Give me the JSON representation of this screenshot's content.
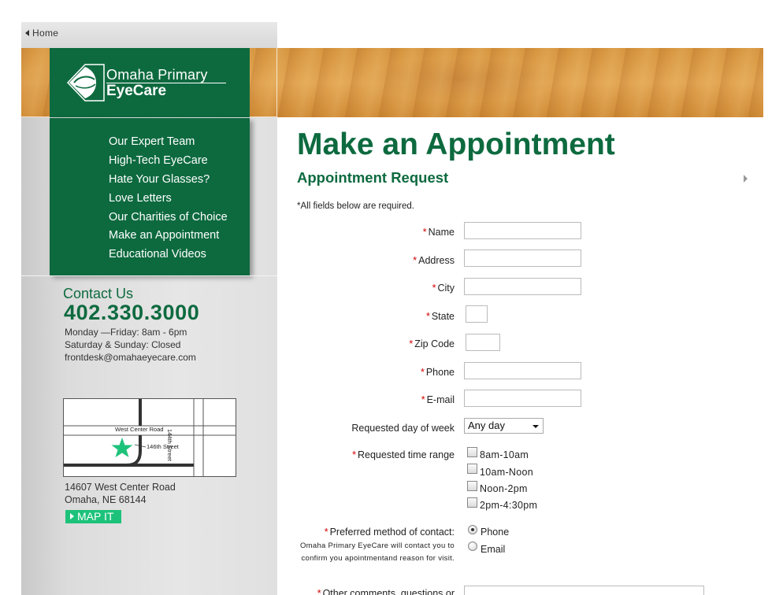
{
  "nav": {
    "home_label": "Home",
    "items": [
      {
        "label": "Our Expert Team"
      },
      {
        "label": "High-Tech EyeCare"
      },
      {
        "label": "Hate Your Glasses?"
      },
      {
        "label": "Love Letters"
      },
      {
        "label": "Our Charities of Choice"
      },
      {
        "label": "Make an Appointment"
      },
      {
        "label": "Educational Videos"
      }
    ]
  },
  "brand": {
    "line1": "Omaha Primary",
    "line2": "EyeCare",
    "green": "#0d6a3f",
    "accent": "#1dc27a"
  },
  "contact": {
    "title": "Contact Us",
    "phone": "402.330.3000",
    "hours_weekday": "Monday —Friday: 8am - 6pm",
    "hours_weekend": "Saturday & Sunday: Closed",
    "email": "frontdesk@omahaeyecare.com",
    "map_labels": {
      "street1": "West Center Road",
      "street2": "146th Street",
      "street3": "144th Street"
    },
    "address_line1": "14607 West Center Road",
    "address_line2": "Omaha, NE 68144",
    "map_button": "MAP IT"
  },
  "main": {
    "title": "Make an Appointment",
    "section_title": "Appointment Request",
    "required_note": "*All fields below are required.",
    "fields": {
      "name": "Name",
      "address": "Address",
      "city": "City",
      "state": "State",
      "zip": "Zip Code",
      "phone": "Phone",
      "email": "E-mail",
      "day_of_week": "Requested day of week",
      "time_range": "Requested time range",
      "preferred_contact": "Preferred method of contact:",
      "contact_help": "Omaha Primary EyeCare will contact you to confirm you apointmentand reason for visit.",
      "comments": "Other comments, questions or"
    },
    "day_select_value": "Any day",
    "time_options": [
      "8am-10am",
      "10am-Noon",
      "Noon-2pm",
      "2pm-4:30pm"
    ],
    "contact_options": [
      {
        "label": "Phone",
        "selected": true
      },
      {
        "label": "Email",
        "selected": false
      }
    ]
  }
}
